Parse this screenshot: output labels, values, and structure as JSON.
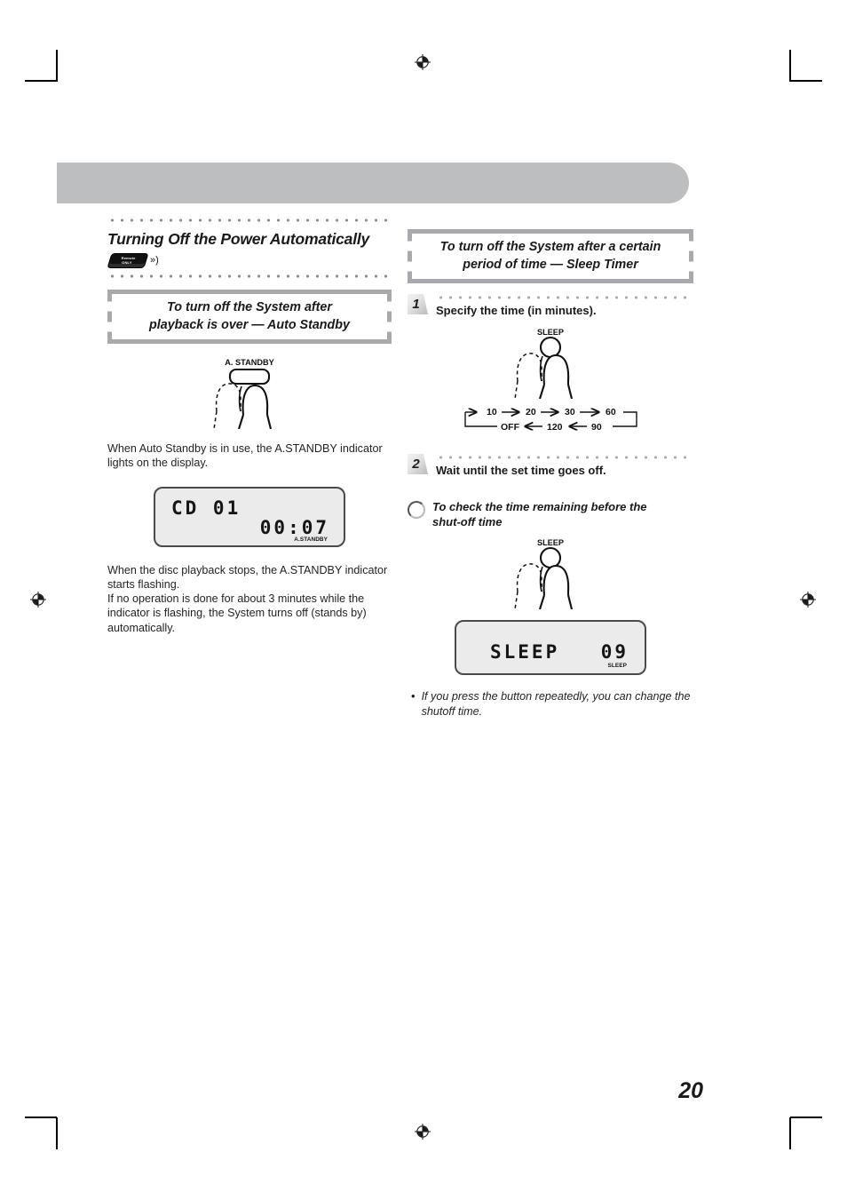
{
  "page": {
    "number": "20"
  },
  "header_bar": {
    "label": ""
  },
  "left_column": {
    "section_title": "Turning Off the Power Automatically",
    "remote_badge": {
      "line1": "Remote",
      "line2": "ONLY",
      "wave": "»)"
    },
    "heading_box": {
      "line1": "To turn off the System after",
      "line2": "playback is over — Auto Standby"
    },
    "illustration": {
      "button_label": "A. STANDBY"
    },
    "paragraph_1": "When Auto Standby is in use, the A.STANDBY indicator lights on the display.",
    "lcd": {
      "primary": "CD 01",
      "secondary": "00:07",
      "indicator": "A.STANDBY"
    },
    "paragraph_2": "When the disc playback stops, the A.STANDBY indicator starts flashing.\nIf no operation is done for about 3 minutes while the indicator is flashing, the System turns off (stands by) automatically."
  },
  "right_column": {
    "heading_box": {
      "line1": "To turn off the System after a certain",
      "line2": "period of time — Sleep Timer"
    },
    "steps": [
      {
        "number": "1",
        "label": "Specify the time (in minutes)."
      },
      {
        "number": "2",
        "label": "Wait until the set time goes off."
      }
    ],
    "illustration_step1": {
      "button_label": "SLEEP"
    },
    "cycle_diagram": {
      "top_row": [
        "10",
        "20",
        "30",
        "60"
      ],
      "bottom_row": [
        "OFF",
        "120",
        "90"
      ]
    },
    "check_heading": {
      "line1": "To check the time remaining before the",
      "line2": "shut-off time"
    },
    "illustration_check": {
      "button_label": "SLEEP"
    },
    "lcd": {
      "primary": "SLEEP",
      "secondary": "09",
      "indicator": "SLEEP"
    },
    "note": {
      "bullet": "•",
      "text": "If you press the button repeatedly, you can change the shutoff time."
    }
  }
}
